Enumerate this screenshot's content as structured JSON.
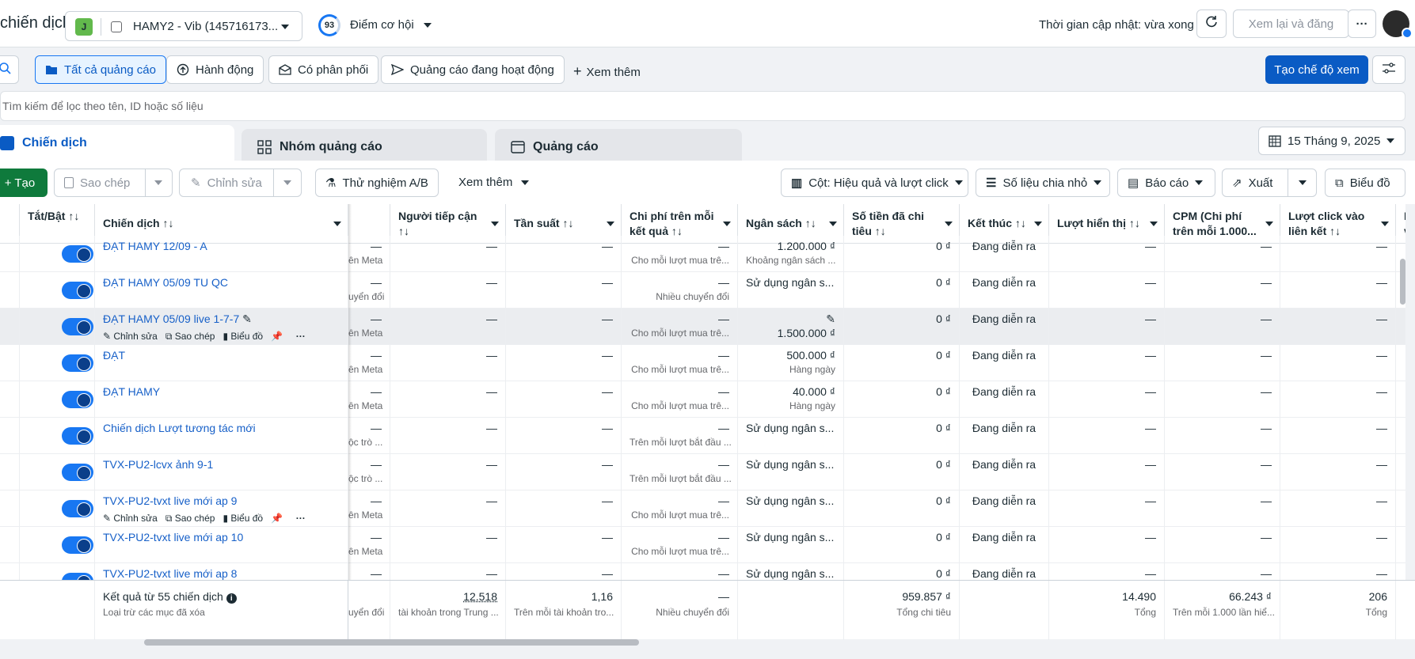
{
  "header": {
    "title": "chiến dịch",
    "account_initial": "J",
    "account_name": "HAMY2 - Vib (145716173...",
    "score": "93",
    "opportunity_label": "Điểm cơ hội",
    "updated": "Thời gian cập nhật: vừa xong",
    "review_publish": "Xem lại và đăng",
    "more": "···"
  },
  "filters": {
    "all_ads": "Tất cả quảng cáo",
    "actions": "Hành động",
    "delivery": "Có phân phối",
    "active_ads": "Quảng cáo đang hoạt động",
    "see_more": "Xem thêm",
    "create_view": "Tạo chế độ xem"
  },
  "search": {
    "placeholder": "Tìm kiếm để lọc theo tên, ID hoặc số liệu"
  },
  "tabs": [
    {
      "label": "Chiến dịch"
    },
    {
      "label": "Nhóm quảng cáo"
    },
    {
      "label": "Quảng cáo"
    }
  ],
  "date_range": "15 Tháng 9, 2025",
  "toolbar": {
    "create": "Tạo",
    "copy": "Sao chép",
    "edit": "Chỉnh sửa",
    "ab_test": "Thử nghiệm A/B",
    "see_more": "Xem thêm",
    "columns": "Cột: Hiệu quả và lượt click",
    "breakdown": "Số liệu chia nhỏ",
    "reports": "Báo cáo",
    "export": "Xuất",
    "charts": "Biểu đồ"
  },
  "columns": {
    "toggle": "Tắt/Bật ↑↓",
    "campaign": "Chiến dịch ↑↓",
    "reach": "Người tiếp cận ↑↓",
    "frequency": "Tần suất ↑↓",
    "cost_per_result": "Chi phí trên mỗi kết quả ↑↓",
    "budget": "Ngân sách ↑↓",
    "amount_spent": "Số tiền đã chi tiêu ↑↓",
    "ends": "Kết thúc ↑↓",
    "impressions": "Lượt hiển thị ↑↓",
    "cpm": "CPM (Chi phí trên mỗi 1.000...",
    "link_clicks": "Lượt click vào liên kết ↑↓",
    "last": "L v"
  },
  "row_actions": {
    "edit": "Chỉnh sửa",
    "copy": "Sao chép",
    "chart": "Biểu đồ"
  },
  "rows": [
    {
      "name": "ĐẠT HAMY 12/09 - A",
      "res_sub": "ên Meta",
      "cpr_sub": "Cho mỗi lượt mua trê...",
      "budget": "1.200.000 ₫",
      "budget_sub": "Khoảng ngân sách ...",
      "spent": "0 ₫",
      "ends": "Đang diễn ra"
    },
    {
      "name": "ĐẠT HAMY 05/09 TU QC",
      "res_sub": "uyển đổi",
      "cpr_sub": "Nhiều chuyển đổi",
      "budget": "Sử dụng ngân s...",
      "budget_sub": "",
      "spent": "0 ₫",
      "ends": "Đang diễn ra"
    },
    {
      "name": "ĐẠT HAMY 05/09 live 1-7-7",
      "res_sub": "ên Meta",
      "cpr_sub": "Cho mỗi lượt mua trê...",
      "budget": "1.500.000 ₫",
      "budget_sub": "",
      "spent": "0 ₫",
      "ends": "Đang diễn ra"
    },
    {
      "name": "ĐẠT",
      "res_sub": "ên Meta",
      "cpr_sub": "Cho mỗi lượt mua trê...",
      "budget": "500.000 ₫",
      "budget_sub": "Hàng ngày",
      "spent": "0 ₫",
      "ends": "Đang diễn ra"
    },
    {
      "name": "ĐẠT HAMY",
      "res_sub": "ên Meta",
      "cpr_sub": "Cho mỗi lượt mua trê...",
      "budget": "40.000 ₫",
      "budget_sub": "Hàng ngày",
      "spent": "0 ₫",
      "ends": "Đang diễn ra"
    },
    {
      "name": "Chiến dịch Lượt tương tác mới",
      "res_sub": "ộc trò ...",
      "cpr_sub": "Trên mỗi lượt bắt đầu ...",
      "budget": "Sử dụng ngân s...",
      "budget_sub": "",
      "spent": "0 ₫",
      "ends": "Đang diễn ra"
    },
    {
      "name": "TVX-PU2-lcvx ảnh 9-1",
      "res_sub": "ộc trò ...",
      "cpr_sub": "Trên mỗi lượt bắt đầu ...",
      "budget": "Sử dụng ngân s...",
      "budget_sub": "",
      "spent": "0 ₫",
      "ends": "Đang diễn ra"
    },
    {
      "name": "TVX-PU2-tvxt live mới ap 9",
      "res_sub": "ên Meta",
      "cpr_sub": "Cho mỗi lượt mua trê...",
      "budget": "Sử dụng ngân s...",
      "budget_sub": "",
      "spent": "0 ₫",
      "ends": "Đang diễn ra"
    },
    {
      "name": "TVX-PU2-tvxt live mới ap 10",
      "res_sub": "ên Meta",
      "cpr_sub": "Cho mỗi lượt mua trê...",
      "budget": "Sử dụng ngân s...",
      "budget_sub": "",
      "spent": "0 ₫",
      "ends": "Đang diễn ra"
    },
    {
      "name": "TVX-PU2-tvxt live mới ap 8",
      "res_sub": "",
      "cpr_sub": "",
      "budget": "Sử dụng ngân s...",
      "budget_sub": "",
      "spent": "0 ₫",
      "ends": "Đang diễn ra"
    }
  ],
  "dash": "—",
  "footer": {
    "results": "Kết quả từ 55 chiến dịch",
    "excluded": "Loại trừ các mục đã xóa",
    "res_sub": "uyển đổi",
    "reach": "12.518",
    "reach_sub": "tài khoản trong Trung ...",
    "frequency": "1,16",
    "frequency_sub": "Trên mỗi tài khoản tro...",
    "cpr": "—",
    "cpr_sub": "Nhiều chuyển đổi",
    "spent": "959.857 ₫",
    "spent_sub": "Tổng chi tiêu",
    "impressions": "14.490",
    "impressions_sub": "Tổng",
    "cpm": "66.243 ₫",
    "cpm_sub": "Trên mỗi 1.000 lần hiể...",
    "clicks": "206",
    "clicks_sub": "Tổng"
  }
}
